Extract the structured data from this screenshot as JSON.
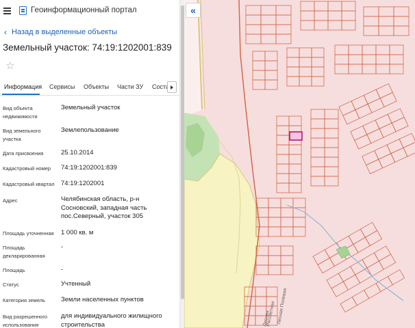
{
  "header": {
    "portal_title": "Геоинформационный портал"
  },
  "nav": {
    "back_label": "Назад в выделенные объекты"
  },
  "object": {
    "title": "Земельный участок: 74:19:1202001:839"
  },
  "tabs": [
    {
      "label": "Информация",
      "active": true
    },
    {
      "label": "Сервисы",
      "active": false
    },
    {
      "label": "Объекты",
      "active": false
    },
    {
      "label": "Части ЗУ",
      "active": false
    },
    {
      "label": "Состав",
      "active": false
    }
  ],
  "attributes": [
    {
      "label": "Вид объекта недвижимости",
      "value": "Земельный участок"
    },
    {
      "label": "Вид земельного участка",
      "value": "Землепользование"
    },
    {
      "label": "Дата присвоения",
      "value": "25.10.2014"
    },
    {
      "label": "Кадастровый номер",
      "value": "74:19:1202001:839"
    },
    {
      "label": "Кадастровый квартал",
      "value": "74:19:1202001"
    },
    {
      "label": "Адрес",
      "value": "Челябинская область, р-н Сосновский, западная часть пос.Северный, участок 305"
    },
    {
      "label": "Площадь уточненная",
      "value": "1 000 кв. м"
    },
    {
      "label": "Площадь декларированная",
      "value": "-"
    },
    {
      "label": "Площадь",
      "value": "-"
    },
    {
      "label": "Статус",
      "value": "Учтенный"
    },
    {
      "label": "Категория земель",
      "value": "Земли населенных пунктов"
    },
    {
      "label": "Вид разрешенного использования",
      "value": "для индивидуального жилищного строительства"
    }
  ],
  "map": {
    "street_labels": [
      "Лесная",
      "Рассветная",
      "Лесная Полевая"
    ],
    "colors": {
      "parcel_fill": "#f7dede",
      "parcel_border": "#d2694e",
      "selected": "#b0187a",
      "field": "#f7f3c2",
      "forest": "#c4e3b4"
    }
  },
  "icons": [
    "menu-icon",
    "portal-logo-icon",
    "chevron-left-icon",
    "star-icon",
    "chevron-right-icon",
    "double-chevron-left-icon"
  ]
}
